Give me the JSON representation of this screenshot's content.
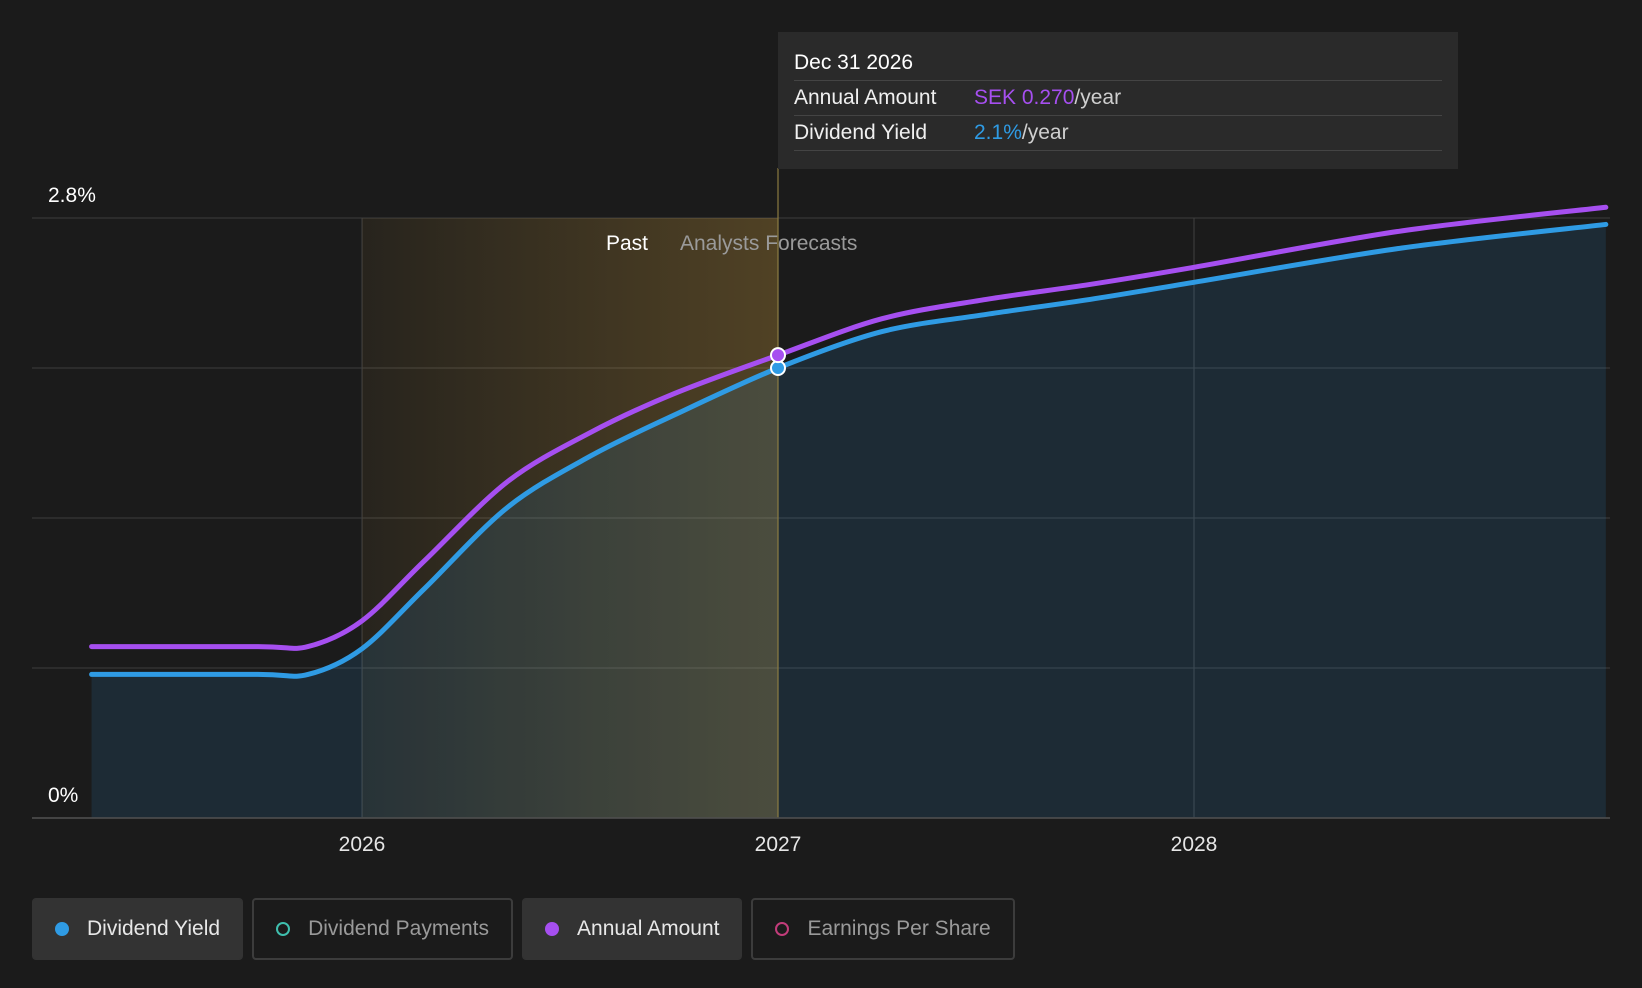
{
  "chart_data": {
    "type": "line",
    "y_axis": {
      "min_label": "0%",
      "max_label": "2.8%",
      "ylim": [
        0,
        2.8
      ]
    },
    "x_axis": {
      "ticks": [
        "2026",
        "2027",
        "2028"
      ],
      "xlim": [
        2025.35,
        2028.99
      ]
    },
    "regions": {
      "past_label": "Past",
      "forecast_label": "Analysts Forecasts",
      "divider_x": 2027.0
    },
    "series": [
      {
        "name": "Dividend Yield",
        "color": "#2f9be4",
        "x": [
          2025.35,
          2025.75,
          2025.87,
          2026.0,
          2026.15,
          2026.35,
          2026.55,
          2026.75,
          2027.0,
          2027.25,
          2027.5,
          2027.75,
          2028.0,
          2028.5,
          2028.99
        ],
        "y": [
          0.67,
          0.67,
          0.67,
          0.79,
          1.07,
          1.45,
          1.69,
          1.88,
          2.1,
          2.27,
          2.35,
          2.42,
          2.5,
          2.66,
          2.77
        ]
      },
      {
        "name": "Annual Amount",
        "color": "#a64ff0",
        "x": [
          2025.35,
          2025.75,
          2025.87,
          2026.0,
          2026.15,
          2026.35,
          2026.55,
          2026.75,
          2027.0,
          2027.25,
          2027.5,
          2027.75,
          2028.0,
          2028.5,
          2028.99
        ],
        "y": [
          0.8,
          0.8,
          0.8,
          0.92,
          1.2,
          1.57,
          1.8,
          1.98,
          2.16,
          2.33,
          2.42,
          2.49,
          2.57,
          2.74,
          2.85
        ]
      }
    ],
    "highlight_x": 2027.0,
    "highlight_values": [
      2.1,
      2.16
    ]
  },
  "tooltip": {
    "date": "Dec 31 2026",
    "rows": [
      {
        "label": "Annual Amount",
        "value": "SEK 0.270",
        "unit": "/year",
        "color": "#a64ff0"
      },
      {
        "label": "Dividend Yield",
        "value": "2.1%",
        "unit": "/year",
        "color": "#2f9be4"
      }
    ]
  },
  "legend": [
    {
      "label": "Dividend Yield",
      "color": "#2f9be4",
      "active": true
    },
    {
      "label": "Dividend Payments",
      "color": "#3fbfae",
      "active": false
    },
    {
      "label": "Annual Amount",
      "color": "#a64ff0",
      "active": true
    },
    {
      "label": "Earnings Per Share",
      "color": "#c23c7a",
      "active": false
    }
  ]
}
